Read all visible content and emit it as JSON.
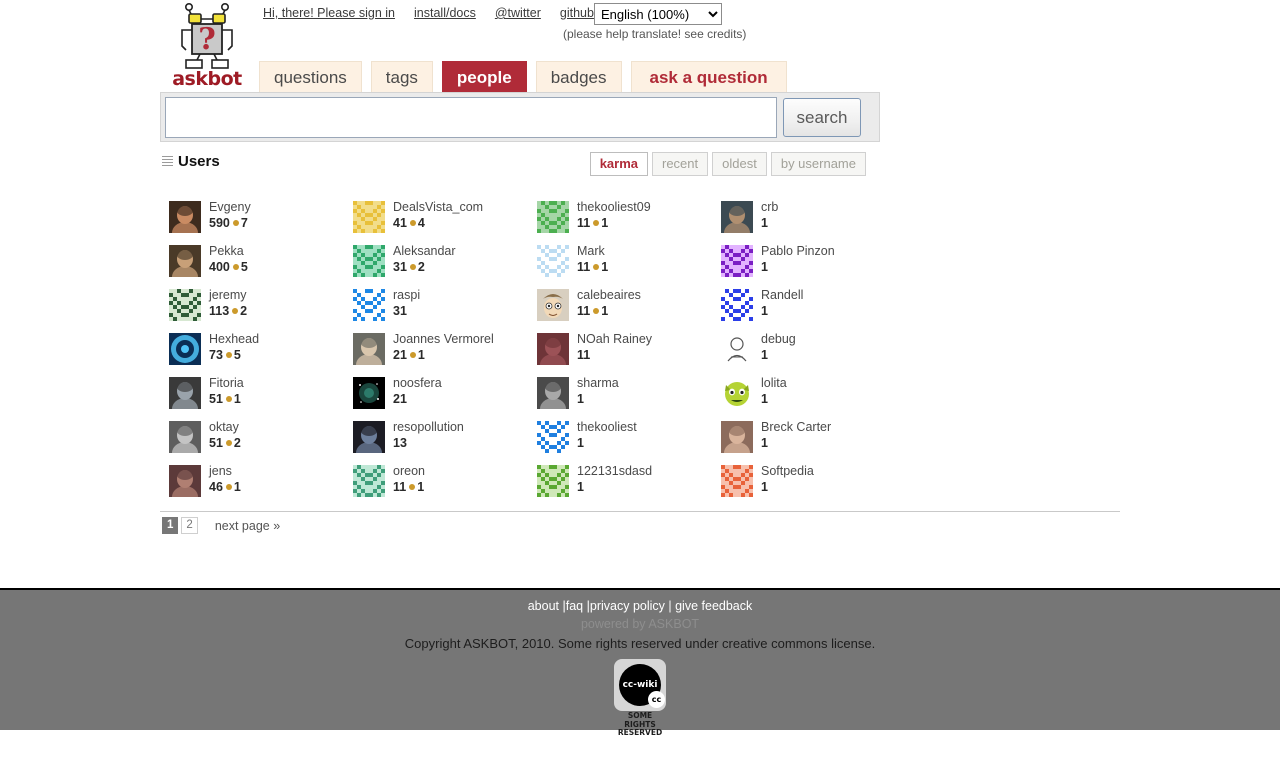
{
  "header": {
    "logo_text": "askbot",
    "logo_alt": "askbot-robot-logo",
    "links": [
      {
        "label": "Hi, there! Please sign in",
        "name": "sign-in-link"
      },
      {
        "label": "install/docs",
        "name": "install-docs-link"
      },
      {
        "label": "@twitter",
        "name": "twitter-link"
      },
      {
        "label": "github",
        "name": "github-link"
      }
    ],
    "language": {
      "selected": "English (100%)",
      "options": [
        "English (100%)"
      ]
    },
    "translate_note": "(please help translate! see credits)"
  },
  "tabs": [
    {
      "label": "questions",
      "active": false
    },
    {
      "label": "tags",
      "active": false
    },
    {
      "label": "people",
      "active": true
    },
    {
      "label": "badges",
      "active": false
    },
    {
      "label": "ask a question",
      "active": false,
      "style": "ask"
    }
  ],
  "search": {
    "value": "",
    "placeholder": "",
    "button_label": "search"
  },
  "users_section": {
    "title": "Users",
    "sorts": [
      {
        "label": "karma",
        "active": true
      },
      {
        "label": "recent",
        "active": false
      },
      {
        "label": "oldest",
        "active": false
      },
      {
        "label": "by username",
        "active": false
      }
    ]
  },
  "users": [
    {
      "name": "Evgeny",
      "karma": "590",
      "badge": "7",
      "avatar": "photo",
      "c1": "#3d2b1e",
      "c2": "#c98b63"
    },
    {
      "name": "DealsVista_com",
      "karma": "41",
      "badge": "4",
      "avatar": "identicon",
      "c1": "#e8c03a",
      "c2": "#f2dd8a"
    },
    {
      "name": "thekooliest09",
      "karma": "11",
      "badge": "1",
      "avatar": "identicon",
      "c1": "#4caf50",
      "c2": "#a5d6a7"
    },
    {
      "name": "crb",
      "karma": "1",
      "badge": "",
      "avatar": "photo",
      "c1": "#3c4a52",
      "c2": "#b08f70"
    },
    {
      "name": "Pekka",
      "karma": "400",
      "badge": "5",
      "avatar": "photo",
      "c1": "#4a3a28",
      "c2": "#c8a078"
    },
    {
      "name": "Aleksandar",
      "karma": "31",
      "badge": "2",
      "avatar": "identicon",
      "c1": "#2fa86b",
      "c2": "#9fe0c2"
    },
    {
      "name": "Mark",
      "karma": "11",
      "badge": "1",
      "avatar": "identicon",
      "c1": "#bcdcf2",
      "c2": "#ffffff"
    },
    {
      "name": "Pablo Pinzon",
      "karma": "1",
      "badge": "",
      "avatar": "identicon",
      "c1": "#7b1fc4",
      "c2": "#e2b3ff"
    },
    {
      "name": "jeremy",
      "karma": "113",
      "badge": "2",
      "avatar": "identicon",
      "c1": "#2f5c38",
      "c2": "#d7e8d2"
    },
    {
      "name": "raspi",
      "karma": "31",
      "badge": "",
      "avatar": "identicon",
      "c1": "#1e88e5",
      "c2": "#ffffff"
    },
    {
      "name": "calebeaires",
      "karma": "11",
      "badge": "1",
      "avatar": "cartoon",
      "c1": "#d8cfc0",
      "c2": "#8a6f4a"
    },
    {
      "name": "Randell",
      "karma": "1",
      "badge": "",
      "avatar": "identicon",
      "c1": "#2b3ee8",
      "c2": "#ffffff"
    },
    {
      "name": "Hexhead",
      "karma": "73",
      "badge": "5",
      "avatar": "circle",
      "c1": "#0b2e55",
      "c2": "#4fc3f7"
    },
    {
      "name": "Joannes Vermorel",
      "karma": "21",
      "badge": "1",
      "avatar": "photo",
      "c1": "#6b6b63",
      "c2": "#d9c6ad"
    },
    {
      "name": "NOah Rainey",
      "karma": "11",
      "badge": "",
      "avatar": "photo",
      "c1": "#6e3438",
      "c2": "#9c5257"
    },
    {
      "name": "debug",
      "karma": "1",
      "badge": "",
      "avatar": "sketch",
      "c1": "#ffffff",
      "c2": "#555555"
    },
    {
      "name": "Fitoria",
      "karma": "51",
      "badge": "1",
      "avatar": "photo",
      "c1": "#3a3a3a",
      "c2": "#9aa3ab"
    },
    {
      "name": "noosfera",
      "karma": "21",
      "badge": "",
      "avatar": "space",
      "c1": "#000000",
      "c2": "#2f7f6f"
    },
    {
      "name": "sharma",
      "karma": "1",
      "badge": "",
      "avatar": "photo",
      "c1": "#4a4a4a",
      "c2": "#a9a9a9"
    },
    {
      "name": "lolita",
      "karma": "1",
      "badge": "",
      "avatar": "monster",
      "c1": "#b5d334",
      "c2": "#8aa81f"
    },
    {
      "name": "oktay",
      "karma": "51",
      "badge": "2",
      "avatar": "photo",
      "c1": "#5e5e5e",
      "c2": "#c4c4c4"
    },
    {
      "name": "resopollution",
      "karma": "13",
      "badge": "",
      "avatar": "photo",
      "c1": "#1c1c24",
      "c2": "#6d7f9c"
    },
    {
      "name": "thekooliest",
      "karma": "1",
      "badge": "",
      "avatar": "identicon",
      "c1": "#1f7fe0",
      "c2": "#ffffff"
    },
    {
      "name": "Breck Carter",
      "karma": "1",
      "badge": "",
      "avatar": "photo",
      "c1": "#8c6b5c",
      "c2": "#d9b49c"
    },
    {
      "name": "jens",
      "karma": "46",
      "badge": "1",
      "avatar": "photo",
      "c1": "#5c3a3a",
      "c2": "#b07f72"
    },
    {
      "name": "oreon",
      "karma": "11",
      "badge": "1",
      "avatar": "identicon",
      "c1": "#3f9e7a",
      "c2": "#bfe8d6"
    },
    {
      "name": "122131sdasd",
      "karma": "1",
      "badge": "",
      "avatar": "identicon",
      "c1": "#5aa832",
      "c2": "#cfe8b8"
    },
    {
      "name": "Softpedia",
      "karma": "1",
      "badge": "",
      "avatar": "identicon",
      "c1": "#e8623a",
      "c2": "#f7c0ad"
    }
  ],
  "pager": {
    "pages": [
      {
        "label": "1",
        "current": true
      },
      {
        "label": "2",
        "current": false
      }
    ],
    "next_label": "next page »"
  },
  "footer": {
    "links": [
      {
        "label": "about"
      },
      {
        "label": "faq"
      },
      {
        "label": "privacy policy"
      },
      {
        "label": "give feedback"
      }
    ],
    "powered": "powered by ASKBOT",
    "copyright": "Copyright ASKBOT, 2010. Some rights reserved under creative commons license.",
    "cc_label": "cc-wiki",
    "cc_mini": "cc",
    "cc_rights_line1": "SOME RIGHTS",
    "cc_rights_line2": "RESERVED"
  },
  "colors": {
    "accent_red": "#b02b38",
    "tab_cream": "#fdf1e3",
    "footer_gray": "#767676",
    "badge_gold": "#cc9a2b"
  }
}
